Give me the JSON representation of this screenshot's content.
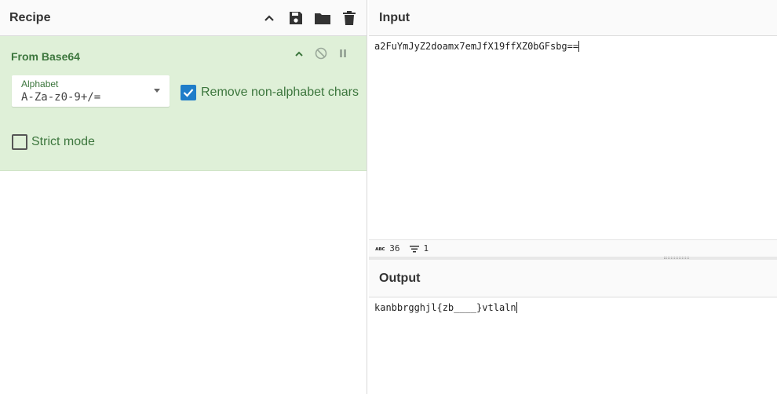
{
  "recipe": {
    "title": "Recipe",
    "icons": [
      "chevron-up-icon",
      "save-icon",
      "folder-icon",
      "trash-icon"
    ],
    "operation": {
      "name": "From Base64",
      "alphabet_label": "Alphabet",
      "alphabet_value": "A-Za-z0-9+/=",
      "remove_non_alpha_label": "Remove non-alphabet chars",
      "remove_non_alpha_checked": true,
      "strict_mode_label": "Strict mode",
      "strict_mode_checked": false
    }
  },
  "input": {
    "title": "Input",
    "text": "a2FuYmJyZ2doamx7emJfX19ffXZ0bGFsbg==",
    "char_count": "36",
    "line_count": "1"
  },
  "output": {
    "title": "Output",
    "text": "kanbbrgghjl{zb____}vtlaln"
  },
  "colors": {
    "operation_bg": "#dff0d8",
    "operation_text": "#3c763d",
    "checkbox_checked": "#1f7dc9"
  }
}
